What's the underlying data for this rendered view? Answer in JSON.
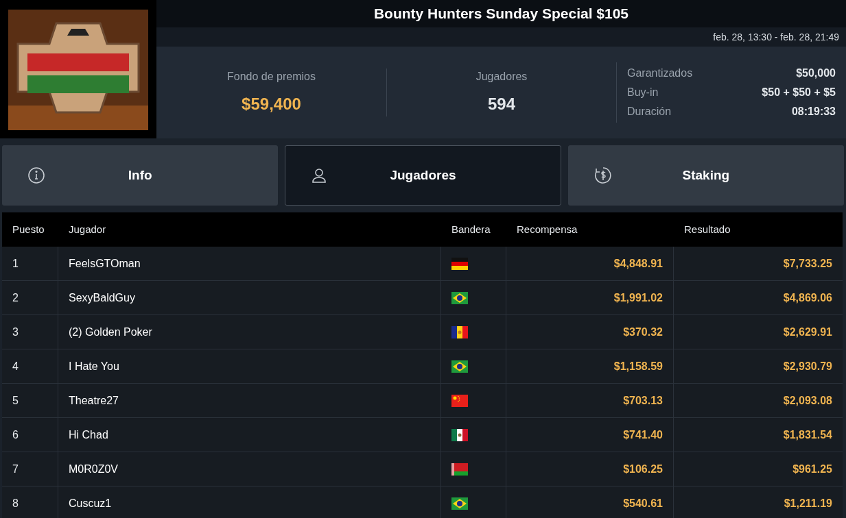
{
  "title": "Bounty Hunters Sunday Special $105",
  "dates": "feb. 28, 13:30 - feb. 28, 21:49",
  "stats": [
    {
      "label": "Fondo de premios",
      "value": "$59,400",
      "kind": "prize"
    },
    {
      "label": "Jugadores",
      "value": "594",
      "kind": "count"
    }
  ],
  "details": [
    {
      "label": "Garantizados",
      "value": "$50,000"
    },
    {
      "label": "Buy-in",
      "value": "$50 + $50 + $5"
    },
    {
      "label": "Duración",
      "value": "08:19:33"
    }
  ],
  "tabs": [
    {
      "label": "Info",
      "selected": false
    },
    {
      "label": "Jugadores",
      "selected": true
    },
    {
      "label": "Staking",
      "selected": false
    }
  ],
  "table": {
    "columns": [
      "Puesto",
      "Jugador",
      "Bandera",
      "Recompensa",
      "Resultado"
    ],
    "rows": [
      {
        "rank": "1",
        "player": "FeelsGTOman",
        "kind": "de",
        "bounty": "$4,848.91",
        "result": "$7,733.25"
      },
      {
        "rank": "2",
        "player": "SexyBaldGuy",
        "kind": "br",
        "bounty": "$1,991.02",
        "result": "$4,869.06"
      },
      {
        "rank": "3",
        "player": "(2) Golden Poker",
        "kind": "ad",
        "bounty": "$370.32",
        "result": "$2,629.91"
      },
      {
        "rank": "4",
        "player": "I Hate You",
        "kind": "br",
        "bounty": "$1,158.59",
        "result": "$2,930.79"
      },
      {
        "rank": "5",
        "player": "Theatre27",
        "kind": "cn",
        "bounty": "$703.13",
        "result": "$2,093.08"
      },
      {
        "rank": "6",
        "player": "Hi Chad",
        "kind": "mx",
        "bounty": "$741.40",
        "result": "$1,831.54"
      },
      {
        "rank": "7",
        "player": "M0R0Z0V",
        "kind": "by",
        "bounty": "$106.25",
        "result": "$961.25"
      },
      {
        "rank": "8",
        "player": "Cuscuz1",
        "kind": "br",
        "bounty": "$540.61",
        "result": "$1,211.19"
      }
    ]
  }
}
